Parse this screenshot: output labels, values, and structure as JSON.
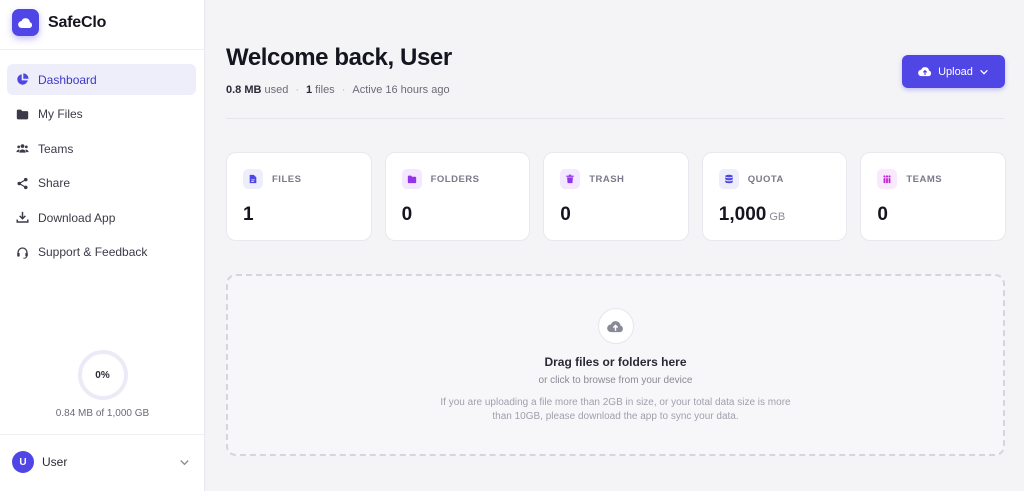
{
  "brand": {
    "name": "SafeClo"
  },
  "nav": {
    "items": [
      {
        "label": "Dashboard",
        "icon": "chart-pie-icon",
        "active": true
      },
      {
        "label": "My Files",
        "icon": "folder-icon"
      },
      {
        "label": "Teams",
        "icon": "users-icon"
      },
      {
        "label": "Share",
        "icon": "share-icon"
      },
      {
        "label": "Download App",
        "icon": "download-icon"
      },
      {
        "label": "Support & Feedback",
        "icon": "headset-icon"
      }
    ]
  },
  "storage": {
    "percent_label": "0%",
    "usage_text": "0.84 MB of 1,000 GB"
  },
  "user": {
    "initial": "U",
    "name": "User"
  },
  "header": {
    "title": "Welcome back, User",
    "used_value": "0.8 MB",
    "used_label": "used",
    "files_value": "1",
    "files_label": "files",
    "activity": "Active 16 hours ago",
    "upload_label": "Upload"
  },
  "stats": [
    {
      "label": "FILES",
      "value": "1",
      "icon": "file-icon",
      "color": "#4f46e5"
    },
    {
      "label": "FOLDERS",
      "value": "0",
      "icon": "folder-icon",
      "color": "#9333ea"
    },
    {
      "label": "TRASH",
      "value": "0",
      "icon": "trash-icon",
      "color": "#9333ea"
    },
    {
      "label": "QUOTA",
      "value": "1,000",
      "unit": "GB",
      "icon": "database-icon",
      "color": "#4f46e5"
    },
    {
      "label": "TEAMS",
      "value": "0",
      "icon": "people-icon",
      "color": "#c026d3"
    }
  ],
  "dropzone": {
    "title": "Drag files or folders here",
    "subtitle": "or click to browse from your device",
    "note": "If you are uploading a file more than 2GB in size, or your total data size is more than 10GB, please download the app to sync your data."
  },
  "colors": {
    "accent": "#4f46e5",
    "accent_soft": "#eeeefb"
  }
}
